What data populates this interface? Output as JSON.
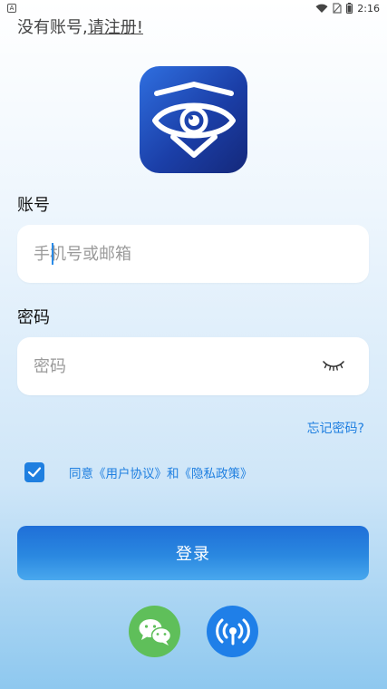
{
  "status_bar": {
    "notification_icon": "A",
    "time": "2:16",
    "icons": [
      "wifi-icon",
      "no-sim-icon",
      "battery-icon"
    ]
  },
  "register": {
    "prompt": "没有账号,",
    "link": "请注册!"
  },
  "logo": {
    "icon": "eye-shield-icon"
  },
  "account": {
    "label": "账号",
    "placeholder": "手机号或邮箱",
    "value": ""
  },
  "password": {
    "label": "密码",
    "placeholder": "密码",
    "value": "",
    "toggle_icon": "eye-closed-icon"
  },
  "forgot_password": "忘记密码?",
  "agreement": {
    "checked": true,
    "text": "同意《用户协议》和《隐私政策》"
  },
  "login_button": "登录",
  "social_login": [
    {
      "name": "wechat",
      "icon": "wechat-icon",
      "color": "#5fbf5a"
    },
    {
      "name": "radio",
      "icon": "broadcast-icon",
      "color": "#1f7fe8"
    }
  ],
  "colors": {
    "accent": "#1f7fe0",
    "logo_dark": "#14287a",
    "logo_light": "#2f6fe0"
  }
}
